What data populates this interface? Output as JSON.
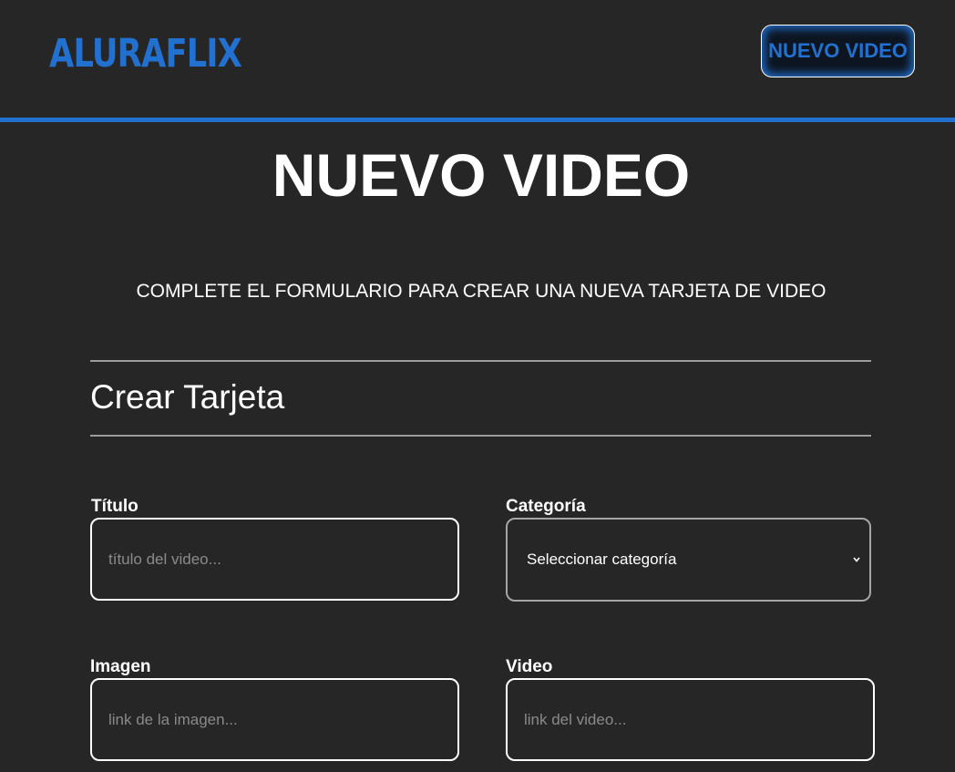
{
  "header": {
    "logo": "ALURAFLIX",
    "new_video_button": "NUEVO VIDEO",
    "accent_color": "#2271d1"
  },
  "main": {
    "title": "NUEVO VIDEO",
    "subtitle": "COMPLETE EL FORMULARIO PARA CREAR UNA NUEVA TARJETA DE VIDEO",
    "section_title": "Crear Tarjeta"
  },
  "form": {
    "titulo": {
      "label": "Título",
      "placeholder": "título del video...",
      "value": ""
    },
    "categoria": {
      "label": "Categoría",
      "selected": "Seleccionar categoría",
      "icon": "chevron-down-icon"
    },
    "imagen": {
      "label": "Imagen",
      "placeholder": "link de la imagen...",
      "value": ""
    },
    "video": {
      "label": "Video",
      "placeholder": "link del video...",
      "value": ""
    }
  }
}
